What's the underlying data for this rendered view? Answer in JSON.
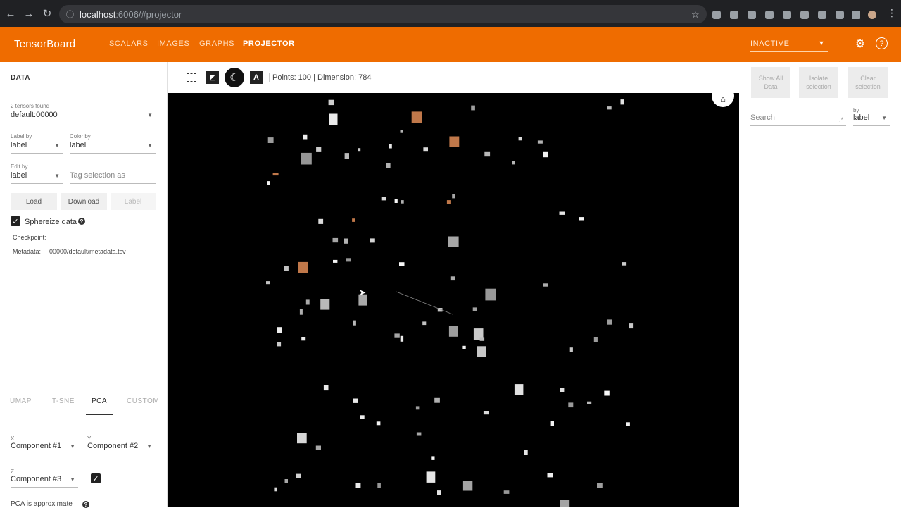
{
  "browser": {
    "url_host": "localhost",
    "url_path": ":6006/#projector"
  },
  "header": {
    "logo": "TensorBoard",
    "tabs": [
      "SCALARS",
      "IMAGES",
      "GRAPHS",
      "PROJECTOR"
    ],
    "active_tab": "PROJECTOR",
    "run_status": "INACTIVE",
    "accent_color": "#ef6c00"
  },
  "left_panel": {
    "title": "DATA",
    "tensors_found": "2 tensors found",
    "tensor_value": "default:00000",
    "label_by_label": "Label by",
    "label_by_value": "label",
    "color_by_label": "Color by",
    "color_by_value": "label",
    "edit_by_label": "Edit by",
    "edit_by_value": "label",
    "tag_placeholder": "Tag selection as",
    "load_button": "Load",
    "download_button": "Download",
    "label_button": "Label",
    "sphereize_label": "Sphereize data",
    "sphereize_checked": true,
    "checkpoint_label": "Checkpoint:",
    "metadata_label": "Metadata:",
    "metadata_value": "00000/default/metadata.tsv",
    "algo_tabs": [
      "UMAP",
      "T-SNE",
      "PCA",
      "CUSTOM"
    ],
    "active_algo": "PCA",
    "x_label": "X",
    "x_value": "Component #1",
    "y_label": "Y",
    "y_value": "Component #2",
    "z_label": "Z",
    "z_value": "Component #3",
    "z_checked": true,
    "pca_note": "PCA is approximate"
  },
  "toolbar": {
    "points_info": "Points: 100 | Dimension: 784"
  },
  "right_panel": {
    "show_all_button": "Show All Data",
    "isolate_button": "Isolate selection",
    "clear_button": "Clear selection",
    "search_placeholder": "Search",
    "by_label": "by",
    "by_value": "label"
  },
  "scatter": {
    "point_count": 100,
    "background": "#000000",
    "highlight_color": "#c0784a"
  }
}
